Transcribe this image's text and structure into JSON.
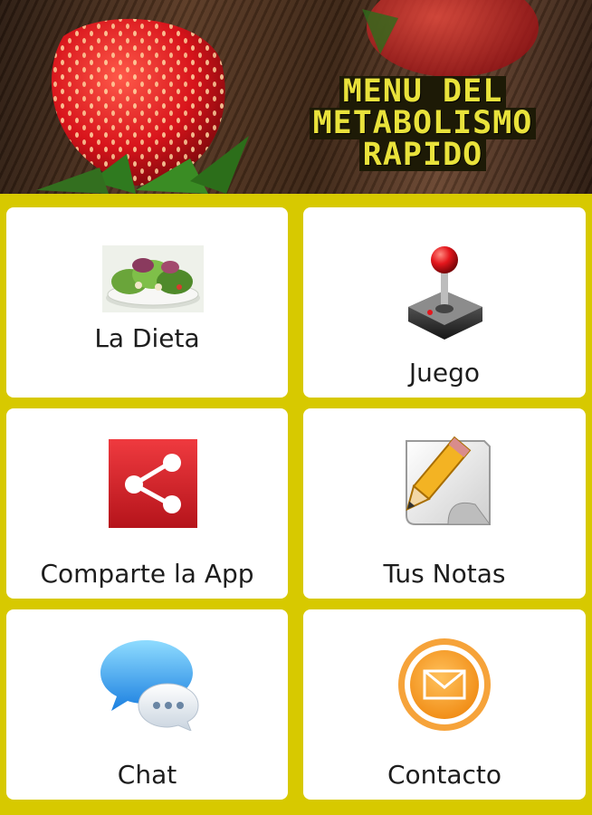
{
  "banner": {
    "title_lines": [
      "MENU DEL",
      "METABOLISMO",
      "RAPIDO"
    ]
  },
  "tiles": [
    {
      "label": "La Dieta",
      "icon": "salad-image"
    },
    {
      "label": "Juego",
      "icon": "joystick-icon"
    },
    {
      "label": "Comparte la App",
      "icon": "share-icon"
    },
    {
      "label": "Tus Notas",
      "icon": "notes-pencil-icon"
    },
    {
      "label": "Chat",
      "icon": "chat-bubbles-icon"
    },
    {
      "label": "Contacto",
      "icon": "mail-icon"
    }
  ],
  "colors": {
    "background": "#d7c900",
    "tile": "#ffffff",
    "title_text": "#e9e23b",
    "share_red": "#d9232a",
    "mail_orange": "#f39c2b"
  }
}
